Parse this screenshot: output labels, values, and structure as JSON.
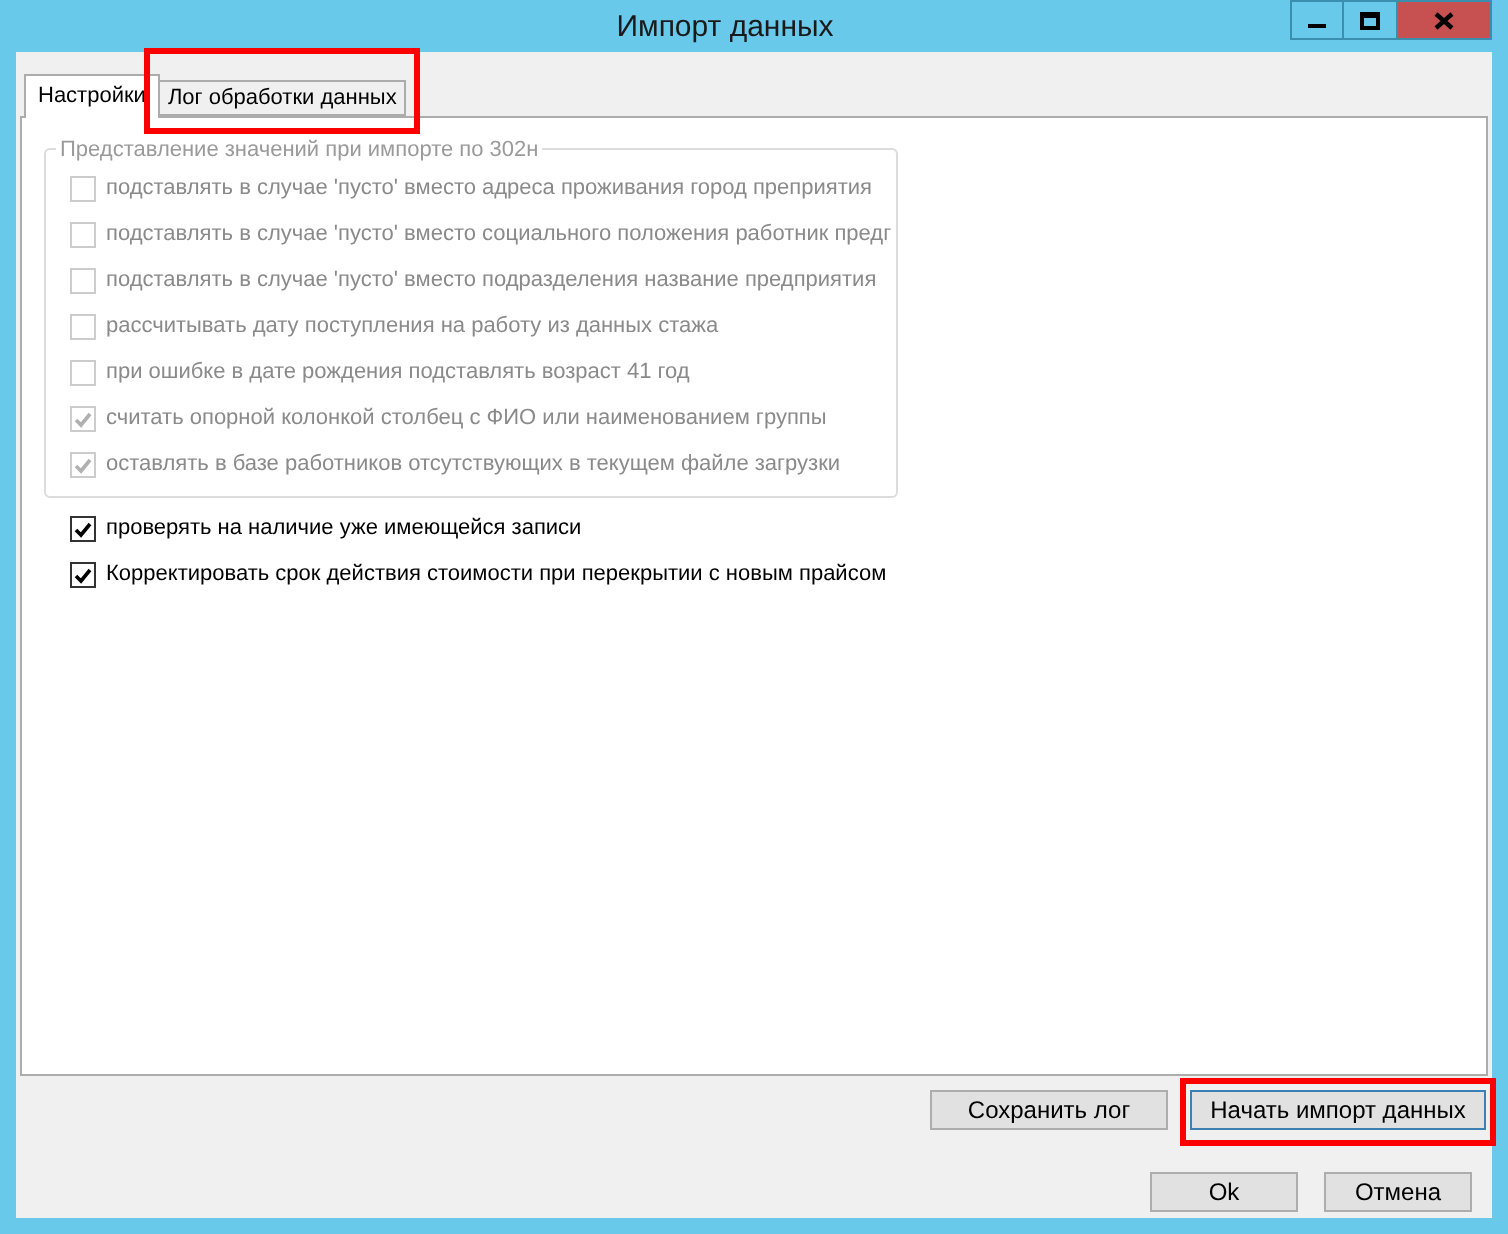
{
  "window": {
    "title": "Импорт данных"
  },
  "tabs": [
    {
      "label": "Настройки",
      "selected": true,
      "highlighted": false
    },
    {
      "label": "Лог обработки данных",
      "selected": false,
      "highlighted": true
    }
  ],
  "group": {
    "title": "Представление значений при импорте по 302н",
    "disabled": true,
    "options": [
      {
        "label": "подставлять в случае 'пусто' вместо адреса проживания город преприятия",
        "checked": false
      },
      {
        "label": "подставлять в случае 'пусто' вместо социального положения работник предг",
        "checked": false
      },
      {
        "label": "подставлять в случае 'пусто' вместо подразделения название предприятия",
        "checked": false
      },
      {
        "label": "рассчитывать дату поступления на работу из данных стажа",
        "checked": false
      },
      {
        "label": "при ошибке в дате рождения подставлять возраст 41 год",
        "checked": false
      },
      {
        "label": "считать опорной колонкой столбец с ФИО или наименованием группы",
        "checked": true
      },
      {
        "label": "оставлять в базе работников отсутствующих в текущем файле загрузки",
        "checked": true
      }
    ]
  },
  "options": [
    {
      "label": "проверять на наличие уже имеющейся записи",
      "checked": true
    },
    {
      "label": "Корректировать срок действия стоимости при перекрытии с новым прайсом",
      "checked": true
    }
  ],
  "panel_buttons": [
    {
      "label": "Сохранить лог",
      "highlighted": false
    },
    {
      "label": "Начать импорт данных",
      "highlighted": true
    }
  ],
  "dialog_buttons": [
    {
      "label": "Ok"
    },
    {
      "label": "Отмена"
    }
  ]
}
